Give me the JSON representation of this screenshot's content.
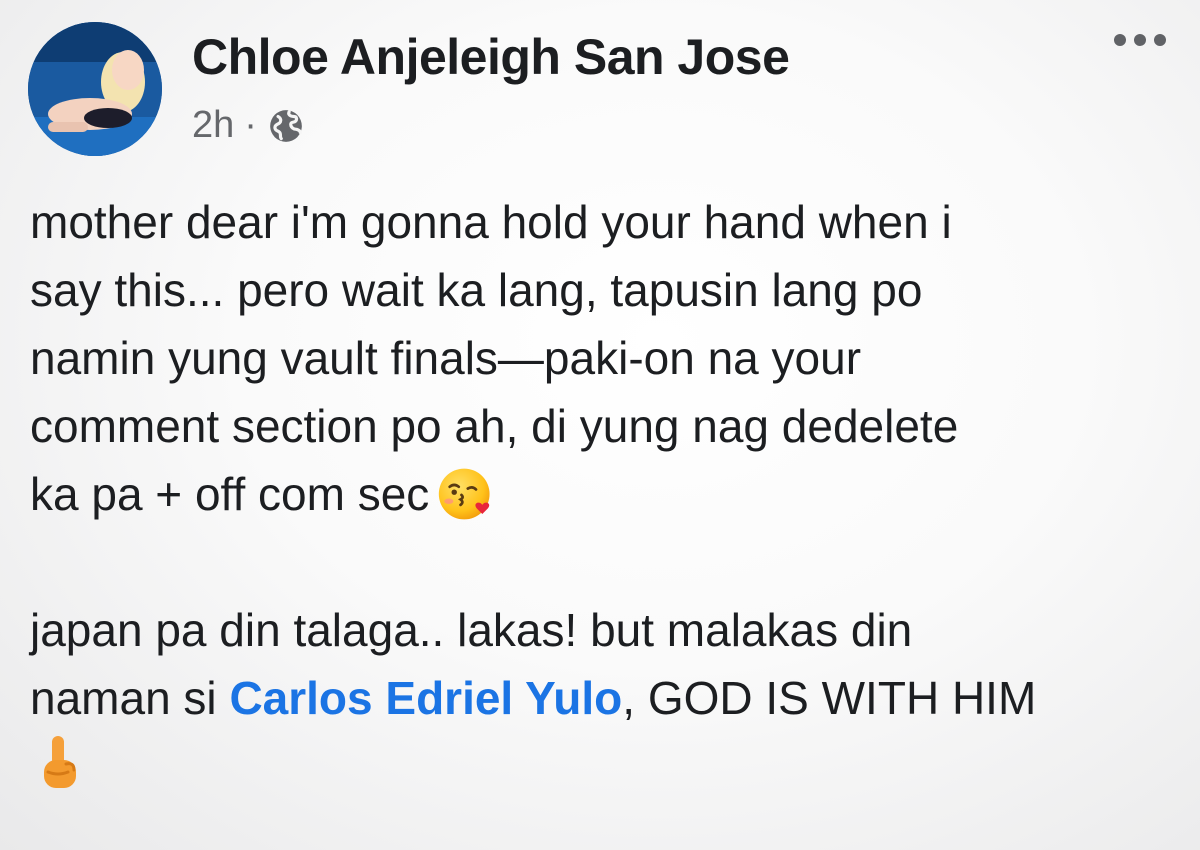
{
  "post": {
    "author": "Chloe Anjeleigh San Jose",
    "time": "2h",
    "separator": "·",
    "privacy_icon": "globe-icon",
    "more_icon": "more-options-icon",
    "paragraph1": {
      "line1": "mother dear i'm gonna hold your hand when i",
      "line2": "say this... pero wait ka lang, tapusin lang po",
      "line3": "namin yung vault finals—paki-on na your",
      "line4": "comment section po ah, di yung nag dedelete",
      "line5": "ka pa + off com sec",
      "emoji": "face-blowing-kiss-emoji"
    },
    "paragraph2": {
      "line1": "japan pa din talaga.. lakas! but malakas din",
      "line2_prefix": "naman si ",
      "mention": "Carlos Edriel Yulo",
      "line2_suffix": ", GOD IS WITH HIM",
      "emoji": "index-pointing-up-emoji"
    },
    "colors": {
      "mention": "#1b74e4",
      "text": "#1c1e21",
      "meta": "#65676b"
    }
  }
}
